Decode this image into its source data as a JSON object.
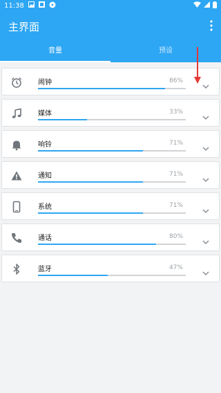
{
  "statusbar": {
    "time": "11:38"
  },
  "appbar": {
    "title": "主界面"
  },
  "tabs": [
    {
      "label": "音量",
      "active": true
    },
    {
      "label": "预设",
      "active": false
    }
  ],
  "items": [
    {
      "label": "闹钟",
      "percent_text": "86%",
      "level": 0.86,
      "icon": "alarm-clock-icon"
    },
    {
      "label": "媒体",
      "percent_text": "33%",
      "level": 0.33,
      "icon": "music-note-icon"
    },
    {
      "label": "响铃",
      "percent_text": "71%",
      "level": 0.71,
      "icon": "bell-icon"
    },
    {
      "label": "通知",
      "percent_text": "71%",
      "level": 0.71,
      "icon": "warning-icon"
    },
    {
      "label": "系统",
      "percent_text": "71%",
      "level": 0.71,
      "icon": "phone-device-icon"
    },
    {
      "label": "通话",
      "percent_text": "80%",
      "level": 0.8,
      "icon": "call-icon"
    },
    {
      "label": "蓝牙",
      "percent_text": "47%",
      "level": 0.47,
      "icon": "bluetooth-icon"
    }
  ],
  "colors": {
    "primary": "#2da6f3",
    "annotation_arrow": "#e53935"
  }
}
